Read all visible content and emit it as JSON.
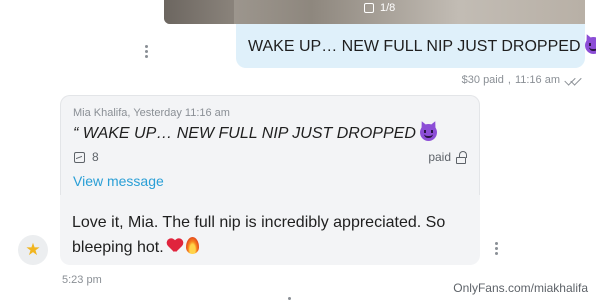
{
  "media_preview": {
    "count": "1/8",
    "watermark_text": "OnlyFans.com/miakhalifa"
  },
  "sent_message": {
    "text": "WAKE UP… NEW FULL NIP JUST DROPPED",
    "emoji": "smiling-face-with-horns",
    "price_status": "$30 paid",
    "time": "11:16 am"
  },
  "received_message": {
    "quote": {
      "author_line": "Mia Khalifa, Yesterday 11:16 am",
      "text": "“ WAKE UP… NEW FULL NIP JUST DROPPED",
      "emoji": "smiling-face-with-horns",
      "media_count": "8",
      "paid_label": "paid",
      "view_link": "View message"
    },
    "text": "Love it, Mia. The full nip is incredibly appreciated. So bleeping hot.",
    "emojis": [
      "red-heart",
      "fire"
    ],
    "time": "5:23 pm"
  },
  "avatar": {
    "icon": "star-icon",
    "glyph": "★"
  },
  "footer": {
    "watermark": "OnlyFans.com/miakhalifa"
  },
  "colors": {
    "sent_bubble": "#dff0fa",
    "received_bubble": "#f3f4f6",
    "link": "#2a9fd6",
    "meta_text": "#8a8f95"
  }
}
